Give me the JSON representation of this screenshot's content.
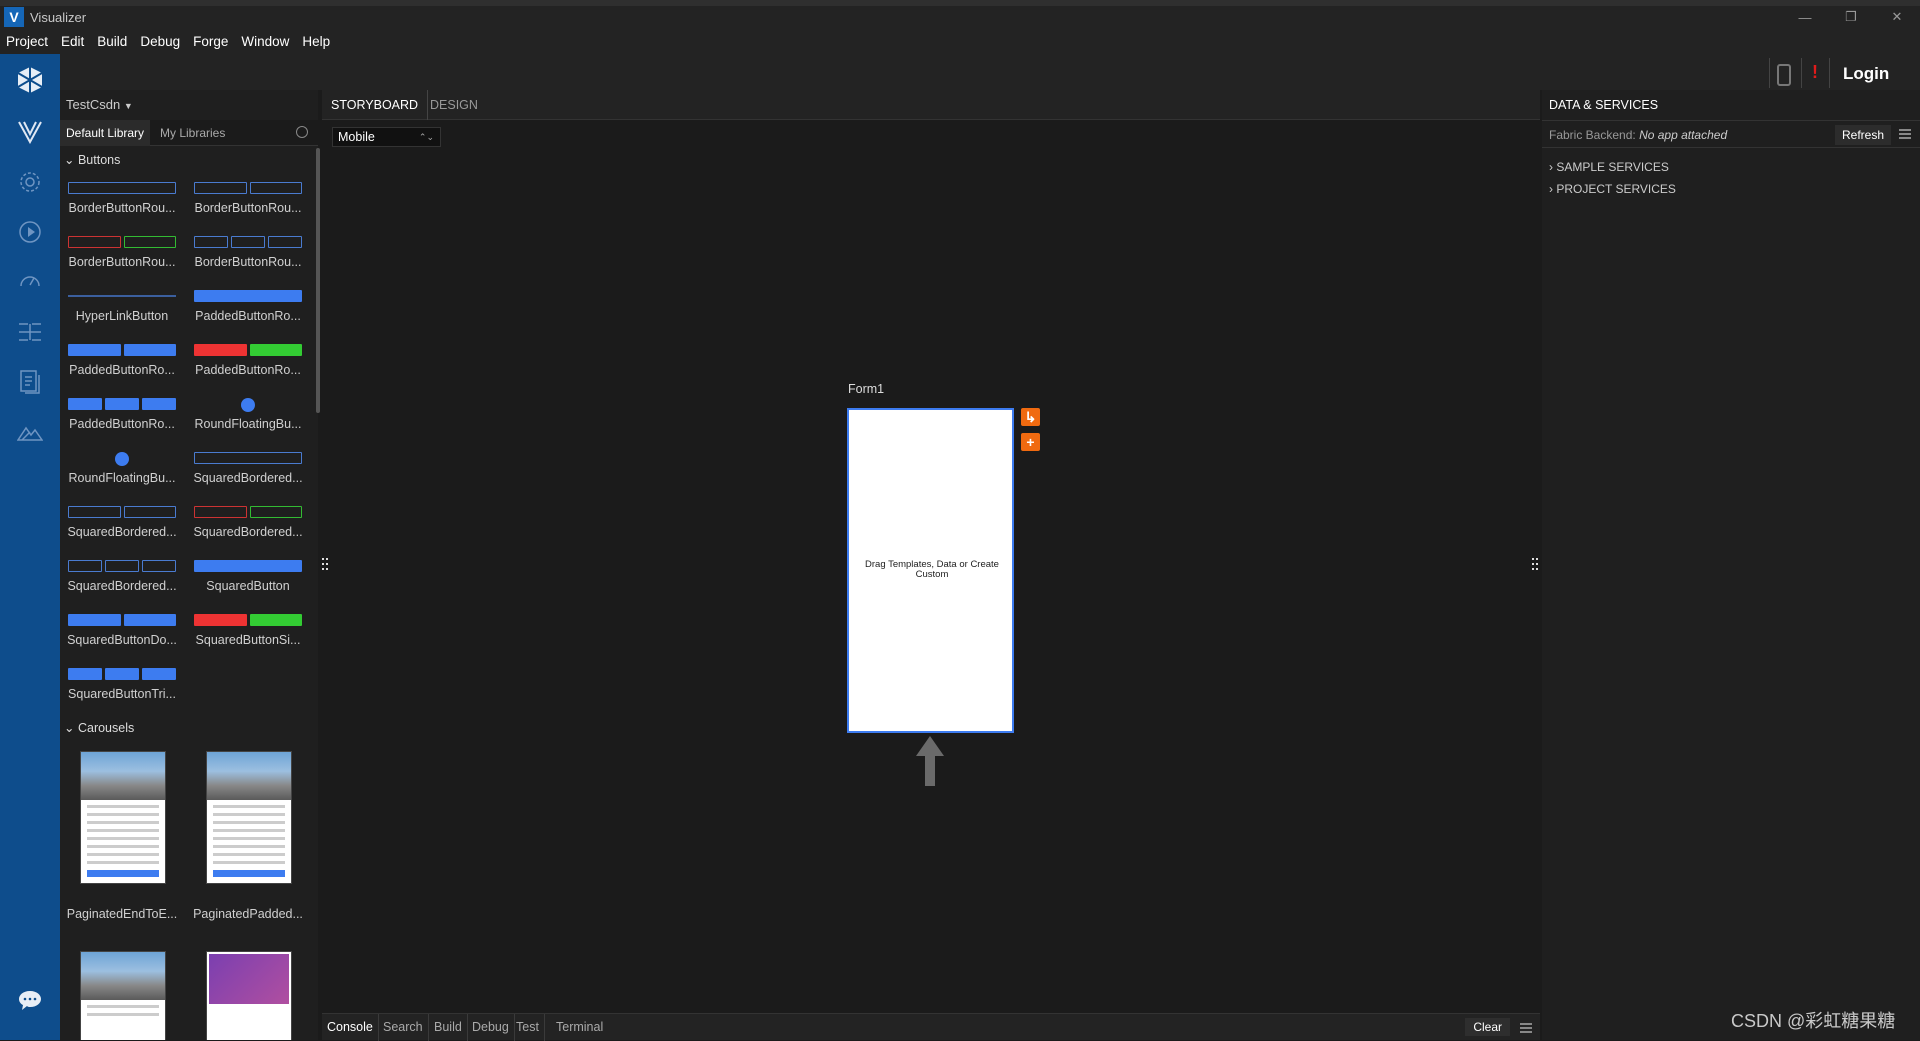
{
  "window": {
    "title": "Visualizer",
    "logo_letter": "V",
    "min": "—",
    "max": "❐",
    "close": "✕"
  },
  "menu": [
    "Project",
    "Edit",
    "Build",
    "Debug",
    "Forge",
    "Window",
    "Help"
  ],
  "topbar": {
    "login_label": "Login",
    "alert_glyph": "!"
  },
  "library": {
    "project_name": "TestCsdn",
    "tabs": [
      "Default Library",
      "My Libraries"
    ],
    "categories": {
      "buttons": "Buttons",
      "carousels": "Carousels"
    },
    "buttons": [
      "BorderButtonRou...",
      "BorderButtonRou...",
      "BorderButtonRou...",
      "BorderButtonRou...",
      "HyperLinkButton",
      "PaddedButtonRo...",
      "PaddedButtonRo...",
      "PaddedButtonRo...",
      "PaddedButtonRo...",
      "RoundFloatingBu...",
      "RoundFloatingBu...",
      "SquaredBordered...",
      "SquaredBordered...",
      "SquaredBordered...",
      "SquaredBordered...",
      "SquaredButton",
      "SquaredButtonDo...",
      "SquaredButtonSi...",
      "SquaredButtonTri..."
    ],
    "carousels": [
      "PaginatedEndToE...",
      "PaginatedPadded..."
    ]
  },
  "center": {
    "tabs": [
      "STORYBOARD",
      "DESIGN"
    ],
    "device": "Mobile",
    "form_name": "Form1",
    "form_hint": "Drag Templates, Data or Create Custom"
  },
  "bottom": {
    "tabs": [
      "Console",
      "Search",
      "Build",
      "Debug",
      "Test",
      "Terminal"
    ],
    "clear_label": "Clear"
  },
  "data_services": {
    "title": "DATA & SERVICES",
    "backend_label": "Fabric Backend:",
    "backend_value": "No app attached",
    "refresh_label": "Refresh",
    "items": [
      "SAMPLE SERVICES",
      "PROJECT SERVICES"
    ]
  },
  "watermark": "CSDN @彩虹糖果糖",
  "colors": {
    "rail": "#0e4d8c",
    "accent": "#3d7cf0",
    "orange": "#f06a10",
    "alert": "#e01b1b"
  }
}
